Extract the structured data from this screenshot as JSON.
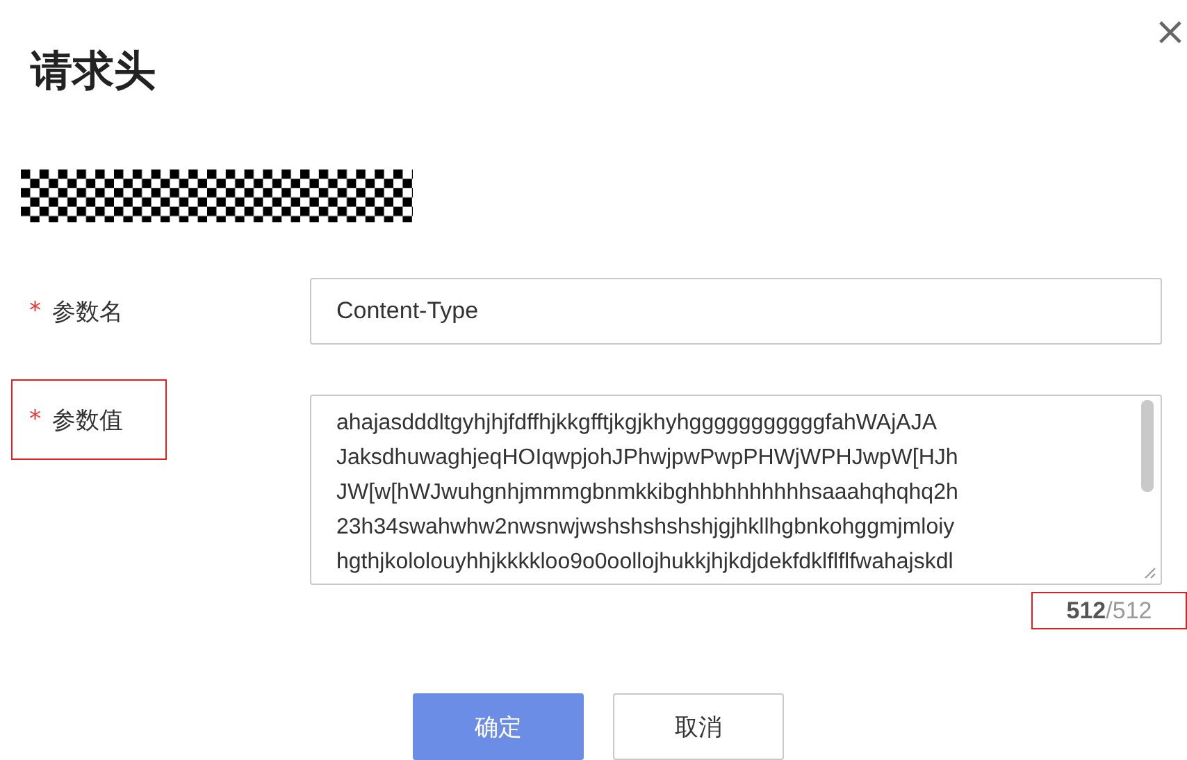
{
  "dialog": {
    "title": "请求头",
    "close": "×"
  },
  "fields": [
    {
      "kind": "input",
      "label": "参数名",
      "required": true,
      "required_mark": "*",
      "highlighted": false,
      "value": "Content-Type"
    },
    {
      "kind": "textarea",
      "label": "参数值",
      "required": true,
      "required_mark": "*",
      "highlighted": true,
      "lines": [
        "ahajasdddltgyhjhjfdffhjkkgfftjkgjkhyhgggggggggggfahWAjAJA",
        "JaksdhuwaghjeqHOIqwpjohJPhwjpwPwpPHWjWPHJwpW[HJh",
        "JW[w[hWJwuhgnhjmmmgbnmkkibghhbhhhhhhhsaaahqhqhq2h",
        "23h34swahwhw2nwsnwjwshshshshshjgjhkllhgbnkohggmjmloiy",
        "hgthjkololouyhhjkkkkloo9o0oollojhukkjhjkdjdekfdklflflfwahajskdl"
      ],
      "counter": "**512**/512",
      "counter_highlighted": true
    }
  ],
  "buttons": [
    {
      "label": "确定",
      "primary": true
    },
    {
      "label": "取消",
      "primary": false
    }
  ]
}
